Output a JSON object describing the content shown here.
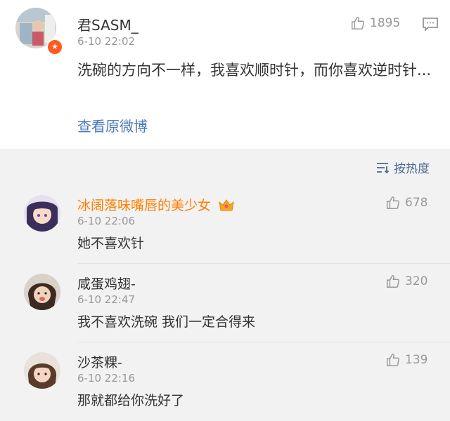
{
  "post": {
    "author": "君SASM_",
    "time": "6-10 22:02",
    "likes": "1895",
    "text": "洗碗的方向不一样，我喜欢顺时针，而你喜欢逆时针...",
    "view_original": "查看原微博",
    "verified_badge": "★"
  },
  "sort": {
    "label": "按热度"
  },
  "comments": [
    {
      "author": "冰阔落味嘴唇的美少女",
      "time": "6-10 22:06",
      "likes": "678",
      "text": "她不喜欢针"
    },
    {
      "author": "咸蛋鸡翅-",
      "time": "6-10 22:47",
      "likes": "320",
      "text": "我不喜欢洗碗 我们一定合得来"
    },
    {
      "author": "沙茶粿-",
      "time": "6-10 22:16",
      "likes": "139",
      "text": "那就都给你洗好了"
    }
  ],
  "colors": {
    "link": "#4a78b8",
    "author_highlight": "#ff7f00",
    "badge": "#ff5a1f"
  },
  "icons": [
    "thumbs-up-icon",
    "comment-icon",
    "sort-icon",
    "crown-icon",
    "verified-icon"
  ]
}
